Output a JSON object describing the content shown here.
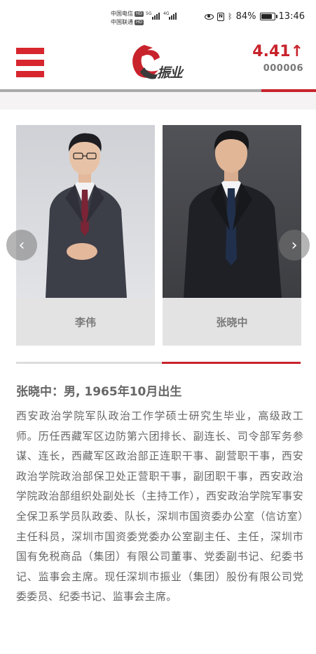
{
  "status_bar": {
    "carrier1": "中国电信",
    "carrier2": "中国联通",
    "hd_badge": "HD",
    "signal1": "5G",
    "signal2": "4G",
    "battery": "84%",
    "time": "13:46"
  },
  "header": {
    "brand_name": "振业",
    "price": "4.41",
    "price_arrow": "↑",
    "stock_code": "000006",
    "accent_color": "#c8232c"
  },
  "carousel": {
    "prev_icon": "‹",
    "next_icon": "›",
    "cards": [
      {
        "name": "李伟"
      },
      {
        "name": "张晓中"
      }
    ]
  },
  "bio": {
    "title": "张晓中：男, 1965年10月出生",
    "body": "西安政治学院军队政治工作学硕士研究生毕业，高级政工师。历任西藏军区边防第六团排长、副连长、司令部军务参谋、连长，西藏军区政治部正连职干事、副营职干事，西安政治学院政治部保卫处正营职干事，副团职干事，西安政治学院政治部组织处副处长（主持工作），西安政治学院军事安全保卫系学员队政委、队长，深圳市国资委办公室（信访室）主任科员，深圳市国资委党委办公室副主任、主任，深圳市国有免税商品（集团）有限公司董事、党委副书记、纪委书记、监事会主席。现任深圳市振业（集团）股份有限公司党委委员、纪委书记、监事会主席。"
  }
}
